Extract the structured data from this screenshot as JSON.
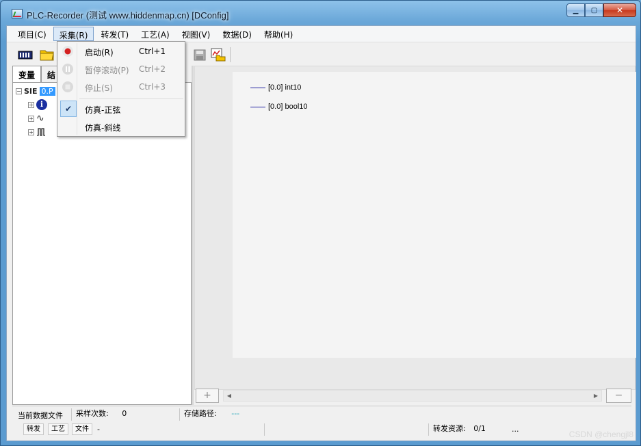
{
  "window": {
    "title": "PLC-Recorder (测试 www.hiddenmap.cn) [DConfig]",
    "min_glyph": "▁",
    "max_glyph": "▢",
    "close_glyph": "✕"
  },
  "menu": [
    "项目(C)",
    "采集(R)",
    "转发(T)",
    "工艺(A)",
    "视图(V)",
    "数据(D)",
    "帮助(H)"
  ],
  "tabs": [
    "变量",
    "结"
  ],
  "tree": {
    "root_label": "SIE",
    "selected_label": "0.P",
    "root_expander": "−",
    "child_expander": "+"
  },
  "legend": [
    {
      "label": "[0.0] int10",
      "color": "#2020a0"
    },
    {
      "label": "[0.0] bool10",
      "color": "#2020a0"
    }
  ],
  "dropdown": {
    "items": [
      {
        "label": "启动(R)",
        "shortcut": "Ctrl+1",
        "icon": "record-icon",
        "enabled": true
      },
      {
        "label": "暂停滚动(P)",
        "shortcut": "Ctrl+2",
        "icon": "pause-icon",
        "enabled": false
      },
      {
        "label": "停止(S)",
        "shortcut": "Ctrl+3",
        "icon": "stop-icon",
        "enabled": false
      },
      {
        "label": "仿真-正弦",
        "shortcut": "",
        "icon": "check-icon",
        "checked": true
      },
      {
        "label": "仿真-斜线",
        "shortcut": "",
        "icon": "",
        "enabled": true
      }
    ],
    "check_glyph": "✔"
  },
  "scroll": {
    "plus": "+",
    "minus": "−",
    "left_arrow": "◀",
    "right_arrow": "▶"
  },
  "status1": {
    "current_file_label": "当前数据文件",
    "sample_count_label": "采样次数:",
    "sample_count_value": "0",
    "storage_path_label": "存储路径:",
    "storage_path_value": "---"
  },
  "status2": {
    "btn_forward": "转发",
    "btn_process": "工艺",
    "btn_file": "文件",
    "file_value": "-",
    "forward_res_label": "转发资源:",
    "forward_res_value": "0/1",
    "ellipsis": "..."
  },
  "watermark": "CSDN @chengjl8",
  "colors": {
    "accent": "#3399ff",
    "record": "#d42020",
    "plot_bg": "#f4f4f4"
  }
}
